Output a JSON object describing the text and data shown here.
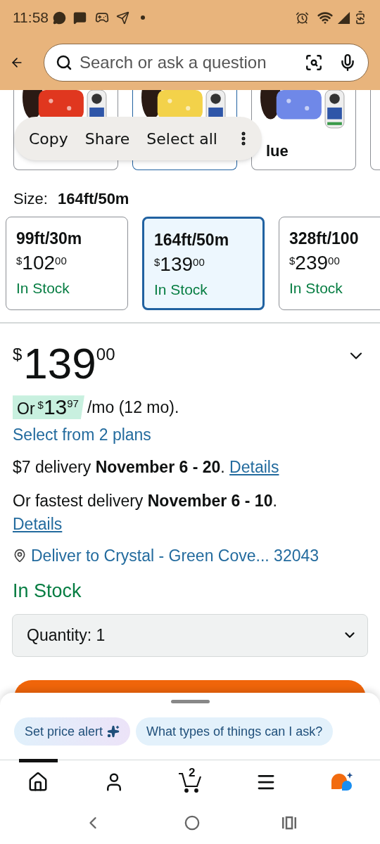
{
  "status_bar": {
    "time": "11:58"
  },
  "search": {
    "placeholder": "Search or ask a question"
  },
  "color_options": [
    {
      "selected": false
    },
    {
      "selected": true
    },
    {
      "selected": false,
      "label": "lue"
    },
    {
      "selected": false
    }
  ],
  "selection_menu": [
    "Copy",
    "Share",
    "Select all"
  ],
  "size": {
    "label": "Size:",
    "value": "164ft/50m"
  },
  "size_options": [
    {
      "name": "99ft/30m",
      "currency": "$",
      "whole": "102",
      "cents": "00",
      "stock": "In Stock",
      "selected": false
    },
    {
      "name": "164ft/50m",
      "currency": "$",
      "whole": "139",
      "cents": "00",
      "stock": "In Stock",
      "selected": true
    },
    {
      "name": "328ft/100",
      "currency": "$",
      "whole": "239",
      "cents": "00",
      "stock": "In Stock",
      "selected": false
    }
  ],
  "price": {
    "currency": "$",
    "whole": "139",
    "cents": "00"
  },
  "monthly": {
    "prefix": "Or",
    "currency": "$",
    "whole": "13",
    "cents": "97",
    "suffix": "/mo (12 mo)."
  },
  "plans_link": "Select from 2 plans",
  "delivery": {
    "text": "$7 delivery **November 6 - 20**.",
    "link": "Details"
  },
  "fastest_delivery": {
    "text": "Or fastest delivery **November 6 - 10**.",
    "link": "Details"
  },
  "deliver_to": "Deliver to Crystal - Green Cove... 32043",
  "availability": "In Stock",
  "quantity": "Quantity: 1",
  "chips": [
    "Set price alert",
    "What types of things can I ask?"
  ],
  "bottom_nav": [
    {
      "kind": "home",
      "selected": true
    },
    {
      "kind": "account",
      "selected": false
    },
    {
      "kind": "cart",
      "selected": false,
      "badge": "2"
    },
    {
      "kind": "menu",
      "selected": false
    },
    {
      "kind": "assistant",
      "selected": false
    }
  ]
}
